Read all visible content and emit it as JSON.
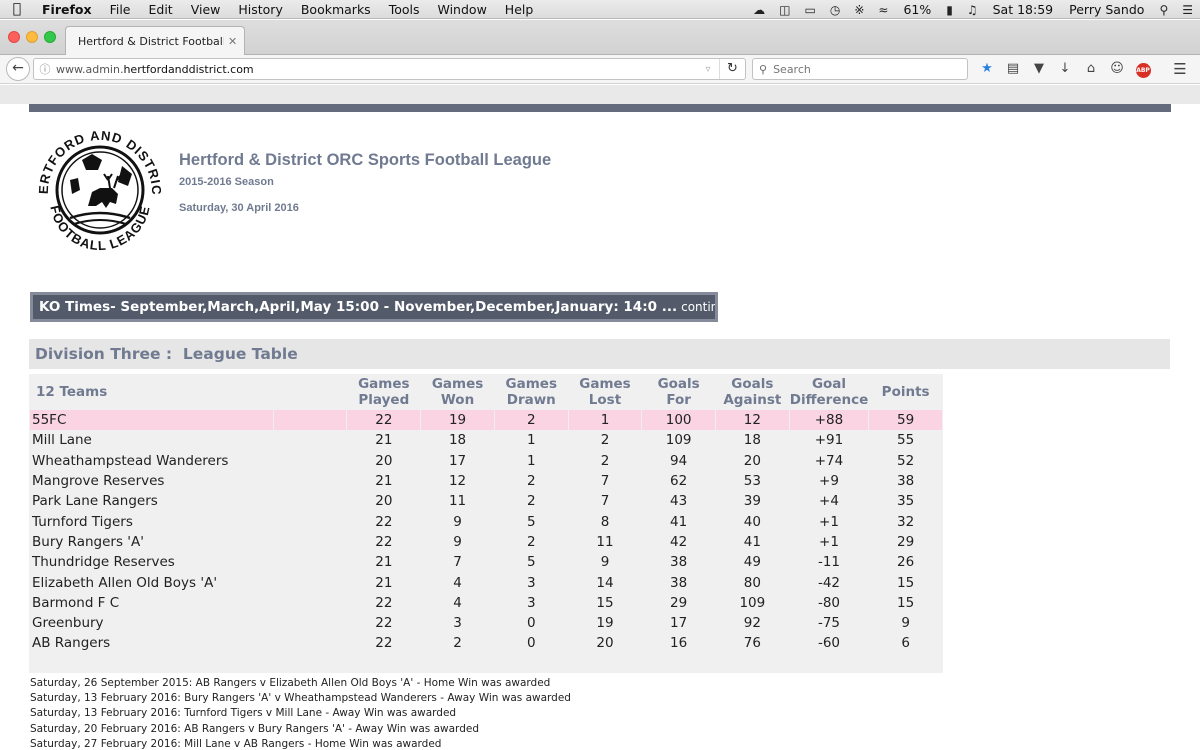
{
  "menubar": {
    "app": "Firefox",
    "menus": [
      "File",
      "Edit",
      "View",
      "History",
      "Bookmarks",
      "Tools",
      "Window",
      "Help"
    ],
    "battery": "61%",
    "clock": "Sat 18:59",
    "user": "Perry Sando"
  },
  "browser": {
    "tab_title": "Hertford & District Football Lea...",
    "url_plain": "www.admin.",
    "url_domain": "hertfordanddistrict.com",
    "search_placeholder": "Search",
    "icons": [
      "back-icon",
      "info-icon",
      "reload-icon",
      "search-icon",
      "bookmark-star-icon",
      "reading-list-icon",
      "pocket-icon",
      "downloads-icon",
      "home-icon",
      "emoji-icon",
      "adblock-icon",
      "menu-icon"
    ],
    "accent": "#2a7fdf"
  },
  "header": {
    "logo_text_top": "HERTFORD AND DISTRICT",
    "logo_text_bottom": "FOOTBALL LEAGUE",
    "title": "Hertford & District ORC Sports Football League",
    "season": "2015-2016 Season",
    "date": "Saturday, 30 April 2016"
  },
  "ticker": {
    "text": "KO Times- September,March,April,May 15:00 - November,December,January: 14:0 ...",
    "more": "continue"
  },
  "division": {
    "title": "Division Three :  League Table"
  },
  "table": {
    "teams_header": "12 Teams",
    "columns": [
      [
        "Games",
        "Played"
      ],
      [
        "Games",
        "Won"
      ],
      [
        "Games",
        "Drawn"
      ],
      [
        "Games",
        "Lost"
      ],
      [
        "Goals",
        "For"
      ],
      [
        "Goals",
        "Against"
      ],
      [
        "Goal",
        "Difference"
      ],
      [
        "Points",
        ""
      ]
    ],
    "highlight_color": "#fad4e3",
    "rows": [
      {
        "team": "55FC",
        "p": "22",
        "w": "19",
        "d": "2",
        "l": "1",
        "f": "100",
        "a": "12",
        "gd": "+88",
        "pts": "59"
      },
      {
        "team": "Mill Lane",
        "p": "21",
        "w": "18",
        "d": "1",
        "l": "2",
        "f": "109",
        "a": "18",
        "gd": "+91",
        "pts": "55"
      },
      {
        "team": "Wheathampstead Wanderers",
        "p": "20",
        "w": "17",
        "d": "1",
        "l": "2",
        "f": "94",
        "a": "20",
        "gd": "+74",
        "pts": "52"
      },
      {
        "team": "Mangrove Reserves",
        "p": "21",
        "w": "12",
        "d": "2",
        "l": "7",
        "f": "62",
        "a": "53",
        "gd": "+9",
        "pts": "38"
      },
      {
        "team": "Park Lane Rangers",
        "p": "20",
        "w": "11",
        "d": "2",
        "l": "7",
        "f": "43",
        "a": "39",
        "gd": "+4",
        "pts": "35"
      },
      {
        "team": "Turnford Tigers",
        "p": "22",
        "w": "9",
        "d": "5",
        "l": "8",
        "f": "41",
        "a": "40",
        "gd": "+1",
        "pts": "32"
      },
      {
        "team": "Bury Rangers 'A'",
        "p": "22",
        "w": "9",
        "d": "2",
        "l": "11",
        "f": "42",
        "a": "41",
        "gd": "+1",
        "pts": "29"
      },
      {
        "team": "Thundridge Reserves",
        "p": "21",
        "w": "7",
        "d": "5",
        "l": "9",
        "f": "38",
        "a": "49",
        "gd": "-11",
        "pts": "26"
      },
      {
        "team": "Elizabeth Allen Old Boys 'A'",
        "p": "21",
        "w": "4",
        "d": "3",
        "l": "14",
        "f": "38",
        "a": "80",
        "gd": "-42",
        "pts": "15"
      },
      {
        "team": "Barmond F C",
        "p": "22",
        "w": "4",
        "d": "3",
        "l": "15",
        "f": "29",
        "a": "109",
        "gd": "-80",
        "pts": "15"
      },
      {
        "team": "Greenbury",
        "p": "22",
        "w": "3",
        "d": "0",
        "l": "19",
        "f": "17",
        "a": "92",
        "gd": "-75",
        "pts": "9"
      },
      {
        "team": "AB Rangers",
        "p": "22",
        "w": "2",
        "d": "0",
        "l": "20",
        "f": "16",
        "a": "76",
        "gd": "-60",
        "pts": "6"
      }
    ]
  },
  "results": [
    "Saturday, 26 September 2015: AB Rangers v Elizabeth Allen Old Boys 'A' - Home Win was awarded",
    "Saturday, 13 February 2016: Bury Rangers 'A' v Wheathampstead Wanderers - Away Win was awarded",
    "Saturday, 13 February 2016: Turnford Tigers v Mill Lane - Away Win was awarded",
    "Saturday, 20 February 2016: AB Rangers v Bury Rangers 'A' - Away Win was awarded",
    "Saturday, 27 February 2016: Mill Lane v AB Rangers - Home Win was awarded"
  ]
}
